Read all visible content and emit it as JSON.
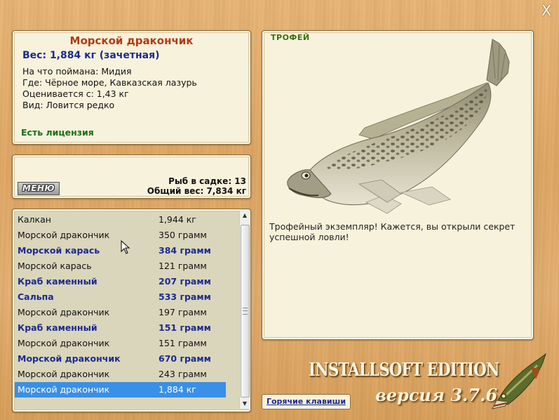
{
  "window": {
    "close_label": "X"
  },
  "fish_info": {
    "name": "Морской дракончик",
    "weight_line": "Вес: 1,884 кг (зачетная)",
    "bait": "На что поймана: Мидия",
    "location": "Где: Чёрное море, Кавказская лазурь",
    "valued_from": "Оценивается с: 1,43 кг",
    "rarity": "Вид: Ловится редко",
    "license": "Есть лицензия"
  },
  "keepnet": {
    "menu_label": "МЕНЮ",
    "fish_count": "Рыб в садке: 13",
    "total_weight": "Общий вес: 7,834 кг"
  },
  "catch_list": [
    {
      "name": "Калкан",
      "weight": "1,944 кг",
      "style": "normal"
    },
    {
      "name": "Морской дракончик",
      "weight": "350 грамм",
      "style": "normal"
    },
    {
      "name": "Морской карась",
      "weight": "384 грамм",
      "style": "bold"
    },
    {
      "name": "Морской карась",
      "weight": "121 грамм",
      "style": "normal"
    },
    {
      "name": "Краб каменный",
      "weight": "207 грамм",
      "style": "bold"
    },
    {
      "name": "Сальпа",
      "weight": "533 грамм",
      "style": "bold"
    },
    {
      "name": "Морской дракончик",
      "weight": "197 грамм",
      "style": "normal"
    },
    {
      "name": "Краб каменный",
      "weight": "151 грамм",
      "style": "bold"
    },
    {
      "name": "Морской дракончик",
      "weight": "151 грамм",
      "style": "normal"
    },
    {
      "name": "Морской дракончик",
      "weight": "670 грамм",
      "style": "bold"
    },
    {
      "name": "Морской дракончик",
      "weight": "243 грамм",
      "style": "normal"
    },
    {
      "name": "Морской дракончик",
      "weight": "1,884 кг",
      "style": "selected"
    }
  ],
  "trophy": {
    "label": "ТРОФЕЙ",
    "description": "Трофейный экземпляр! Кажется, вы открыли секрет успешной ловли!"
  },
  "footer": {
    "hotkeys_label": "Горячие клавиши",
    "edition": "INSTALLSOFT EDITION",
    "version": "версия 3.7.6"
  },
  "colors": {
    "title_red": "#b33a10",
    "highlight_blue": "#1c2a90",
    "license_green": "#1a6e16",
    "selection": "#3a8fe6"
  }
}
